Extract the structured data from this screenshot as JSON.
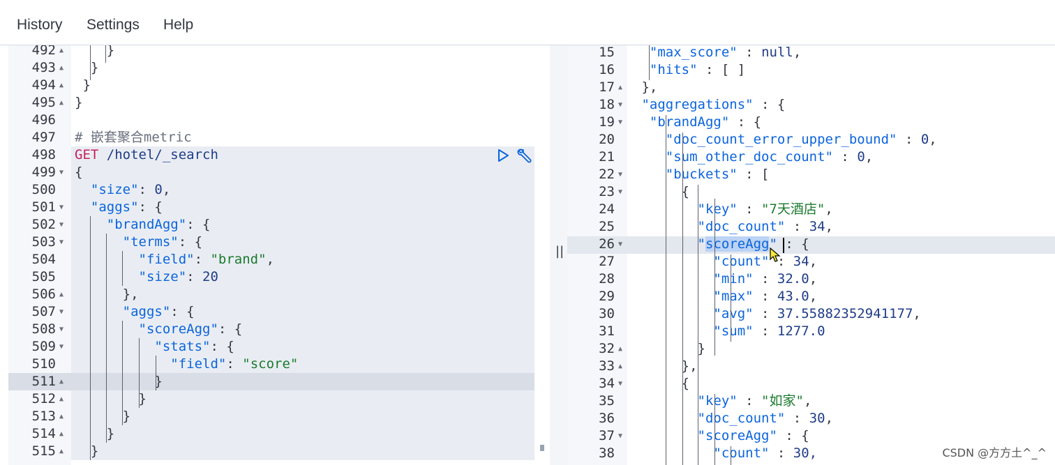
{
  "menu": {
    "history": "History",
    "settings": "Settings",
    "help": "Help"
  },
  "left_editor": {
    "lines": [
      {
        "num": "492",
        "fold": "▲",
        "html": "<span class='p'>    }</span>"
      },
      {
        "num": "493",
        "fold": "▲",
        "html": "<span class='p'>  }</span>"
      },
      {
        "num": "494",
        "fold": "▲",
        "html": "<span class='p'> }</span>"
      },
      {
        "num": "495",
        "fold": "▲",
        "html": "<span class='p'>}</span>"
      },
      {
        "num": "496",
        "fold": "",
        "html": ""
      },
      {
        "num": "497",
        "fold": "",
        "html": "<span class='c'># 嵌套聚合metric</span>"
      },
      {
        "num": "498",
        "fold": "",
        "html": "<span class='m'>GET</span> <span class='n'>/hotel/_search</span>"
      },
      {
        "num": "499",
        "fold": "▼",
        "html": "<span class='p'>{</span>"
      },
      {
        "num": "500",
        "fold": "",
        "html": "  <span class='k'>\"size\"</span><span class='p'>: </span><span class='n'>0</span><span class='p'>,</span>"
      },
      {
        "num": "501",
        "fold": "▼",
        "html": "  <span class='k'>\"aggs\"</span><span class='p'>: {</span>"
      },
      {
        "num": "502",
        "fold": "▼",
        "html": "    <span class='k'>\"brandAgg\"</span><span class='p'>: {</span>"
      },
      {
        "num": "503",
        "fold": "▼",
        "html": "      <span class='k'>\"terms\"</span><span class='p'>: {</span>"
      },
      {
        "num": "504",
        "fold": "",
        "html": "        <span class='k'>\"field\"</span><span class='p'>: </span><span class='s'>\"brand\"</span><span class='p'>,</span>"
      },
      {
        "num": "505",
        "fold": "",
        "html": "        <span class='k'>\"size\"</span><span class='p'>: </span><span class='n'>20</span>"
      },
      {
        "num": "506",
        "fold": "▲",
        "html": "      <span class='p'>},</span>"
      },
      {
        "num": "507",
        "fold": "▼",
        "html": "      <span class='k'>\"aggs\"</span><span class='p'>: {</span>"
      },
      {
        "num": "508",
        "fold": "▼",
        "html": "        <span class='k'>\"scoreAgg\"</span><span class='p'>: {</span>"
      },
      {
        "num": "509",
        "fold": "▼",
        "html": "          <span class='k'>\"stats\"</span><span class='p'>: {</span>"
      },
      {
        "num": "510",
        "fold": "",
        "html": "            <span class='k'>\"field\"</span><span class='p'>: </span><span class='s'>\"score\"</span>"
      },
      {
        "num": "511",
        "fold": "▲",
        "html": "          <span class='p'>}</span>"
      },
      {
        "num": "512",
        "fold": "▲",
        "html": "        <span class='p'>}</span>"
      },
      {
        "num": "513",
        "fold": "▲",
        "html": "      <span class='p'>}</span>"
      },
      {
        "num": "514",
        "fold": "▲",
        "html": "    <span class='p'>}</span>"
      },
      {
        "num": "515",
        "fold": "▲",
        "html": "  <span class='p'>}</span>"
      }
    ]
  },
  "right_editor": {
    "lines": [
      {
        "num": "15",
        "fold": "",
        "html": "  <span class='k'>\"max_score\"</span><span class='p'> : </span><span class='n'>null</span><span class='p'>,</span>"
      },
      {
        "num": "16",
        "fold": "",
        "html": "  <span class='k'>\"hits\"</span><span class='p'> : [ ]</span>"
      },
      {
        "num": "17",
        "fold": "▲",
        "html": " <span class='p'>},</span>"
      },
      {
        "num": "18",
        "fold": "▼",
        "html": " <span class='k'>\"aggregations\"</span><span class='p'> : {</span>"
      },
      {
        "num": "19",
        "fold": "▼",
        "html": "  <span class='k'>\"brandAgg\"</span><span class='p'> : {</span>"
      },
      {
        "num": "20",
        "fold": "",
        "html": "    <span class='k'>\"doc_count_error_upper_bound\"</span><span class='p'> : </span><span class='n'>0</span><span class='p'>,</span>"
      },
      {
        "num": "21",
        "fold": "",
        "html": "    <span class='k'>\"sum_other_doc_count\"</span><span class='p'> : </span><span class='n'>0</span><span class='p'>,</span>"
      },
      {
        "num": "22",
        "fold": "▼",
        "html": "    <span class='k'>\"buckets\"</span><span class='p'> : [</span>"
      },
      {
        "num": "23",
        "fold": "▼",
        "html": "      <span class='p'>{</span>"
      },
      {
        "num": "24",
        "fold": "",
        "html": "        <span class='k'>\"key\"</span><span class='p'> : </span><span class='s'>\"7天酒店\"</span><span class='p'>,</span>"
      },
      {
        "num": "25",
        "fold": "",
        "html": "        <span class='k'>\"doc_count\"</span><span class='p'> : </span><span class='n'>34</span><span class='p'>,</span>"
      },
      {
        "num": "26",
        "fold": "▼",
        "html": "        <span class='k'>\"<span class='hl-word'>scoreAgg</span>\"</span><span class='p'> : {</span>"
      },
      {
        "num": "27",
        "fold": "",
        "html": "          <span class='k'>\"count\"</span><span class='p'> : </span><span class='n'>34</span><span class='p'>,</span>"
      },
      {
        "num": "28",
        "fold": "",
        "html": "          <span class='k'>\"min\"</span><span class='p'> : </span><span class='n'>32.0</span><span class='p'>,</span>"
      },
      {
        "num": "29",
        "fold": "",
        "html": "          <span class='k'>\"max\"</span><span class='p'> : </span><span class='n'>43.0</span><span class='p'>,</span>"
      },
      {
        "num": "30",
        "fold": "",
        "html": "          <span class='k'>\"avg\"</span><span class='p'> : </span><span class='n'>37.55882352941177</span><span class='p'>,</span>"
      },
      {
        "num": "31",
        "fold": "",
        "html": "          <span class='k'>\"sum\"</span><span class='p'> : </span><span class='n'>1277.0</span>"
      },
      {
        "num": "32",
        "fold": "▲",
        "html": "        <span class='p'>}</span>"
      },
      {
        "num": "33",
        "fold": "▲",
        "html": "      <span class='p'>},</span>"
      },
      {
        "num": "34",
        "fold": "▼",
        "html": "      <span class='p'>{</span>"
      },
      {
        "num": "35",
        "fold": "",
        "html": "        <span class='k'>\"key\"</span><span class='p'> : </span><span class='s'>\"如家\"</span><span class='p'>,</span>"
      },
      {
        "num": "36",
        "fold": "",
        "html": "        <span class='k'>\"doc_count\"</span><span class='p'> : </span><span class='n'>30</span><span class='p'>,</span>"
      },
      {
        "num": "37",
        "fold": "▼",
        "html": "        <span class='k'>\"scoreAgg\"</span><span class='p'> : {</span>"
      },
      {
        "num": "38",
        "fold": "",
        "html": "          <span class='k'>\"count\"</span><span class='p'> : </span><span class='n'>30,</span>"
      }
    ]
  },
  "divider_glyph": "||",
  "watermark": "CSDN @方方土^_^",
  "icons": {
    "run": "play-icon",
    "settings": "wrench-icon"
  }
}
